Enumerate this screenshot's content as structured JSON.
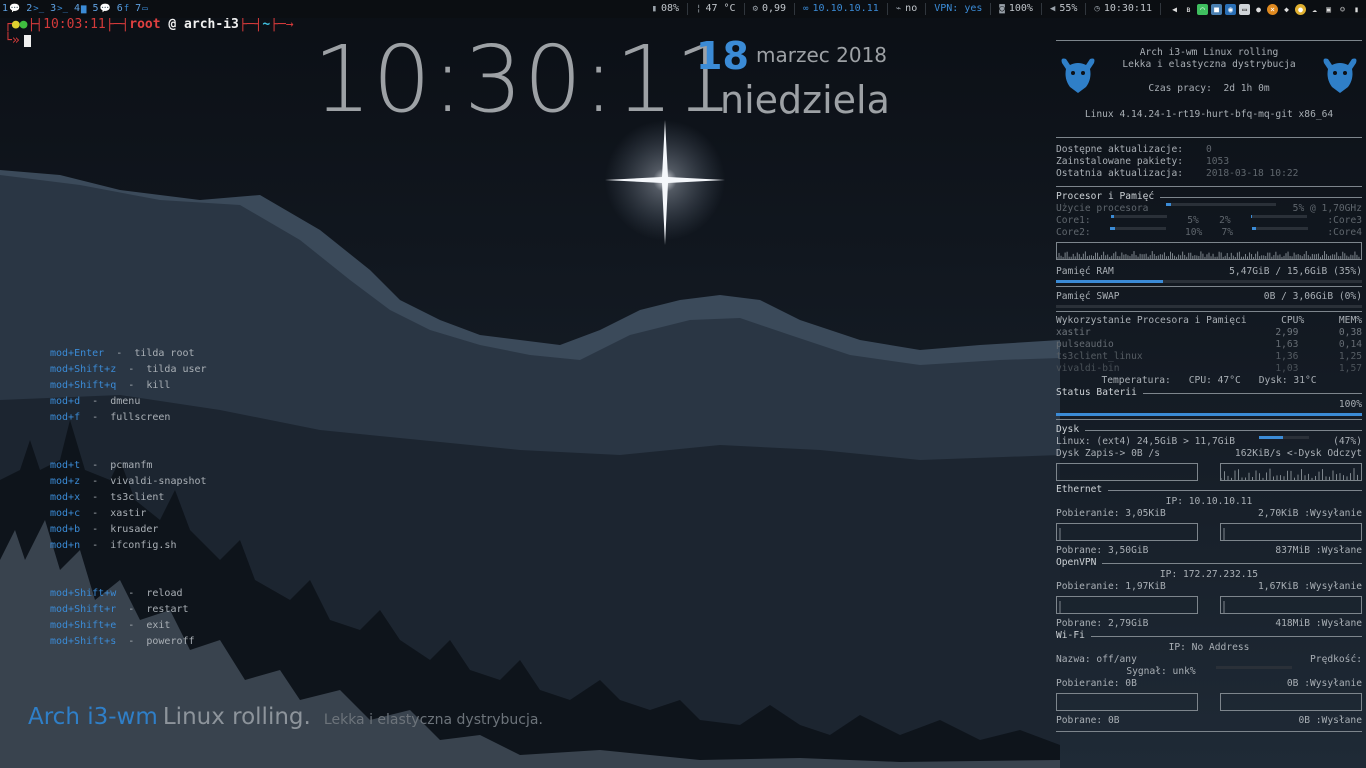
{
  "workspaces": [
    {
      "num": "1",
      "icon": "chat-icon"
    },
    {
      "num": "2",
      "icon": "terminal-icon"
    },
    {
      "num": "3",
      "icon": "terminal-icon"
    },
    {
      "num": "4",
      "icon": "folder-icon"
    },
    {
      "num": "5",
      "icon": "chat-icon"
    },
    {
      "num": "6",
      "icon": "facebook-icon"
    },
    {
      "num": "7",
      "icon": "monitor-icon"
    }
  ],
  "status": {
    "battery_small": "08%",
    "temp": "47 °C",
    "load": "0,99",
    "ip": "10.10.10.11",
    "wifi": "no",
    "vpn_label": "VPN:",
    "vpn_val": "yes",
    "disk_pct": "100%",
    "volume": "55%",
    "time": "10:30:11"
  },
  "terminal": {
    "time": "10:03:11",
    "user": "root",
    "at": "@",
    "host": "arch-i3",
    "dir": "~",
    "prompt": "»"
  },
  "clock": {
    "time": "10:30:11",
    "day": "18",
    "month_year": "marzec 2018",
    "weekday": "niedziela"
  },
  "keybinds": [
    {
      "group": 1,
      "items": [
        {
          "key": "mod+Enter",
          "desc": "tilda root"
        },
        {
          "key": "mod+Shift+z",
          "desc": "tilda user"
        },
        {
          "key": "mod+Shift+q",
          "desc": "kill"
        },
        {
          "key": "mod+d",
          "desc": "dmenu"
        },
        {
          "key": "mod+f",
          "desc": "fullscreen"
        }
      ]
    },
    {
      "group": 2,
      "items": [
        {
          "key": "mod+t",
          "desc": "pcmanfm"
        },
        {
          "key": "mod+z",
          "desc": "vivaldi-snapshot"
        },
        {
          "key": "mod+x",
          "desc": "ts3client"
        },
        {
          "key": "mod+c",
          "desc": "xastir"
        },
        {
          "key": "mod+b",
          "desc": "krusader"
        },
        {
          "key": "mod+n",
          "desc": "ifconfig.sh"
        }
      ]
    },
    {
      "group": 3,
      "items": [
        {
          "key": "mod+Shift+w",
          "desc": "reload"
        },
        {
          "key": "mod+Shift+r",
          "desc": "restart"
        },
        {
          "key": "mod+Shift+e",
          "desc": "exit"
        },
        {
          "key": "mod+Shift+s",
          "desc": "poweroff"
        }
      ]
    }
  ],
  "brand": {
    "a": "Arch i3-wm",
    "b": "Linux rolling.",
    "c": "Lekka i elastyczna dystrybucja."
  },
  "conky": {
    "title": "Arch i3-wm Linux rolling",
    "subtitle": "Lekka i elastyczna dystrybucja",
    "uptime_label": "Czas pracy:",
    "uptime": "2d 1h 0m",
    "kernel": "Linux 4.14.24-1-rt19-hurt-bfq-mq-git x86_64",
    "updates": [
      {
        "label": "Dostępne aktualizacje:",
        "value": "0"
      },
      {
        "label": "Zainstalowane pakiety:",
        "value": "1053"
      },
      {
        "label": "Ostatnia aktualizacja:",
        "value": "2018-03-18 10:22"
      }
    ],
    "cpu_title": "Procesor i Pamięć",
    "cpu_usage_label": "Użycie procesora",
    "cpu_usage": "5% @ 1,70GHz",
    "cpu_usage_pct": 5,
    "cores": [
      {
        "l": "Core1:",
        "v": "5%",
        "pct": 5,
        "r": "2%",
        "rl": ":Core3",
        "rpct": 2
      },
      {
        "l": "Core2:",
        "v": "10%",
        "pct": 10,
        "r": "7%",
        "rl": ":Core4",
        "rpct": 7
      }
    ],
    "ram_label": "Pamięć RAM",
    "ram": "5,47GiB / 15,6GiB (35%)",
    "ram_pct": 35,
    "swap_label": "Pamięć SWAP",
    "swap": "0B   / 3,06GiB (0%)",
    "swap_pct": 0,
    "proc_title": "Wykorzystanie Procesora i Pamięci",
    "proc_cpu": "CPU%",
    "proc_mem": "MEM%",
    "procs": [
      {
        "n": "xastir",
        "c": "2,99",
        "m": "0,38"
      },
      {
        "n": "pulseaudio",
        "c": "1,63",
        "m": "0,14"
      },
      {
        "n": "ts3client_linux",
        "c": "1,36",
        "m": "1,25"
      },
      {
        "n": "vivaldi-bin",
        "c": "1,03",
        "m": "1,57"
      }
    ],
    "temp_label": "Temperatura:",
    "temp_cpu": "CPU: 47°C",
    "temp_disk": "Dysk: 31°C",
    "battery_title": "Status Baterii",
    "battery": "100%",
    "battery_pct": 100,
    "disk_title": "Dysk",
    "disk_line": "Linux:  (ext4)    24,5GiB > 11,7GiB",
    "disk_pct": "(47%)",
    "disk_pct_num": 47,
    "disk_write": "Dysk Zapis-> 0B  /s",
    "disk_read": "162KiB/s <-Dysk Odczyt",
    "eth_title": "Ethernet",
    "eth_ip": "IP: 10.10.10.11",
    "eth_down": "Pobieranie:  3,05KiB",
    "eth_up": "2,70KiB  :Wysyłanie",
    "eth_total_down": "Pobrane: 3,50GiB",
    "eth_total_up": "837MiB :Wysłane",
    "vpn_title": "OpenVPN",
    "vpn_ip": "IP: 172.27.232.15",
    "vpn_down": "Pobieranie:  1,97KiB",
    "vpn_up": "1,67KiB  :Wysyłanie",
    "vpn_total_down": "Pobrane: 2,79GiB",
    "vpn_total_up": "418MiB :Wysłane",
    "wifi_title": "Wi-Fi",
    "wifi_ip": "IP: No Address",
    "wifi_name": "Nazwa:  off/any",
    "wifi_speed": "Prędkość:",
    "wifi_signal": "Sygnał:  unk%",
    "wifi_down": "Pobieranie:  0B",
    "wifi_up": "0B  :Wysyłanie",
    "wifi_total_down": "Pobrane: 0B",
    "wifi_total_up": "0B  :Wysłane"
  }
}
